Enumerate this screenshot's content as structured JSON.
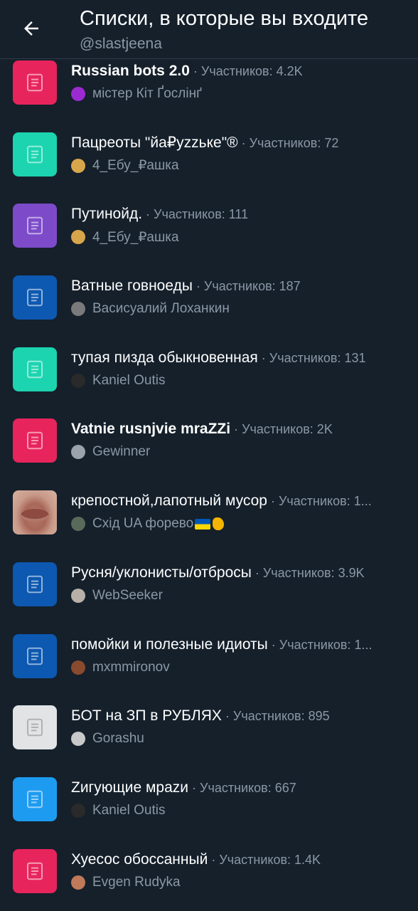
{
  "header": {
    "title": "Списки, в которые вы входите",
    "handle": "@slastjeena",
    "back_icon": "arrow-left-icon"
  },
  "colors": {
    "background": "#15202b",
    "secondary_text": "#8b98a5"
  },
  "lists": [
    {
      "name": "Russian bots 2.0",
      "bold": true,
      "members": "· Участников: 4.2K",
      "owner": "містер Кіт Ґослінґ",
      "thumb_color": "#e8245c",
      "icon": "list-icon",
      "owner_avatar_color": "#9b2bd1"
    },
    {
      "name": "Пацреоты \"йа₽yzzьке\"®",
      "bold": false,
      "members": "· Участников: 72",
      "owner": "4_Ебу_₽ашка",
      "thumb_color": "#1cd4b0",
      "icon": "list-icon",
      "owner_avatar_color": "#d8a64a"
    },
    {
      "name": "Путинойд.",
      "bold": false,
      "members": "· Участников: 111",
      "owner": "4_Ебу_₽ашка",
      "thumb_color": "#7d4bc9",
      "icon": "list-icon",
      "owner_avatar_color": "#d8a64a"
    },
    {
      "name": "Ватные говноеды",
      "bold": false,
      "members": "· Участников: 187",
      "owner": "Васисуалий Лоханкин",
      "thumb_color": "#0d58b0",
      "icon": "list-icon",
      "owner_avatar_color": "#7a7a7a"
    },
    {
      "name": "тупая пизда обыкновенная",
      "bold": false,
      "members": "· Участников: 131",
      "owner": "Kaniel Outis",
      "thumb_color": "#1cd4b0",
      "icon": "list-icon",
      "owner_avatar_color": "#2a2a2a"
    },
    {
      "name": "Vatnie rusnjvie mraZZi",
      "bold": true,
      "members": "· Участников: 2K",
      "owner": "Gewinner",
      "thumb_color": "#e8245c",
      "icon": "list-icon",
      "owner_avatar_color": "#9aa3ab"
    },
    {
      "name": "крепостной,лапотный мусор",
      "bold": false,
      "members": "· Участников: 1...",
      "owner": "Схід UA форево",
      "thumb_color": "photo",
      "icon": "lips-photo",
      "owner_avatar_color": "#5a6a5a",
      "owner_emoji": [
        "ukraine-flag-icon",
        "flexed-biceps-icon"
      ]
    },
    {
      "name": "Русня/уклонисты/отбросы",
      "bold": false,
      "members": "· Участников: 3.9K",
      "owner": "WebSeeker",
      "thumb_color": "#0d58b0",
      "icon": "list-icon",
      "owner_avatar_color": "#b9b0a8"
    },
    {
      "name": "помойки и полезные идиоты",
      "bold": false,
      "members": "· Участников: 1...",
      "owner": "mxmmironov",
      "thumb_color": "#0d58b0",
      "icon": "list-icon",
      "owner_avatar_color": "#8a4a2e"
    },
    {
      "name": "БОТ на ЗП в РУБЛЯХ",
      "bold": false,
      "members": "· Участников: 895",
      "owner": "Gorashu",
      "thumb_color": "#e1e3e5",
      "icon": "list-icon",
      "owner_avatar_color": "#c8c8c8"
    },
    {
      "name": "Zигующие мраzи",
      "bold": false,
      "members": "· Участников: 667",
      "owner": "Kaniel Outis",
      "thumb_color": "#1d9bf0",
      "icon": "list-icon",
      "owner_avatar_color": "#2a2a2a"
    },
    {
      "name": "Хуесос обоссанный",
      "bold": false,
      "members": "· Участников: 1.4K",
      "owner": "Evgen Rudyka",
      "thumb_color": "#e8245c",
      "icon": "list-icon",
      "owner_avatar_color": "#c07a5a"
    }
  ]
}
